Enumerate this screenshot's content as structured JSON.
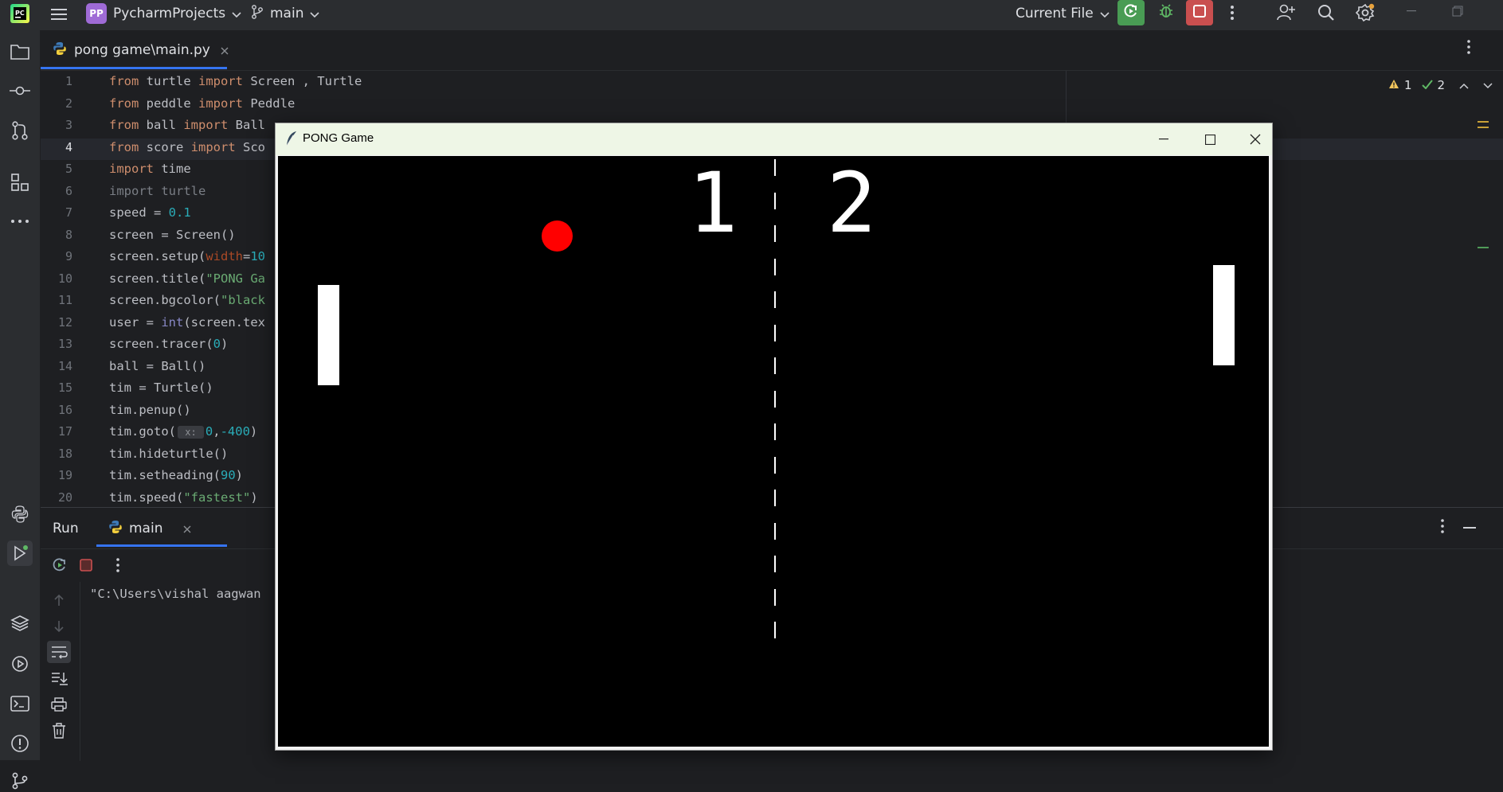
{
  "titlebar": {
    "project_badge": "PP",
    "project_name": "PycharmProjects",
    "branch": "main",
    "run_config": "Current File"
  },
  "editor_tab": {
    "label": "pong game\\main.py"
  },
  "inspections": {
    "warnings": "1",
    "checks": "2"
  },
  "editor": {
    "line_numbers": [
      "1",
      "2",
      "3",
      "4",
      "5",
      "6",
      "7",
      "8",
      "9",
      "10",
      "11",
      "12",
      "13",
      "14",
      "15",
      "16",
      "17",
      "18",
      "19",
      "20"
    ],
    "lines": [
      [
        {
          "t": "from",
          "c": "kw"
        },
        {
          "t": " turtle ",
          "c": ""
        },
        {
          "t": "import",
          "c": "kw"
        },
        {
          "t": " Screen , Turtle",
          "c": ""
        }
      ],
      [
        {
          "t": "from",
          "c": "kw"
        },
        {
          "t": " peddle ",
          "c": ""
        },
        {
          "t": "import",
          "c": "kw"
        },
        {
          "t": " Peddle",
          "c": ""
        }
      ],
      [
        {
          "t": "from",
          "c": "kw"
        },
        {
          "t": " ball ",
          "c": ""
        },
        {
          "t": "import",
          "c": "kw"
        },
        {
          "t": " Ball",
          "c": ""
        }
      ],
      [
        {
          "t": "from",
          "c": "kw"
        },
        {
          "t": " score ",
          "c": ""
        },
        {
          "t": "import",
          "c": "kw"
        },
        {
          "t": " Sco",
          "c": ""
        }
      ],
      [
        {
          "t": "import",
          "c": "kw"
        },
        {
          "t": " time",
          "c": ""
        }
      ],
      [
        {
          "t": "import turtle",
          "c": "gray"
        }
      ],
      [
        {
          "t": "speed = ",
          "c": ""
        },
        {
          "t": "0.1",
          "c": "num"
        }
      ],
      [
        {
          "t": "screen = Screen()",
          "c": ""
        }
      ],
      [
        {
          "t": "screen.setup(",
          "c": ""
        },
        {
          "t": "width",
          "c": "param"
        },
        {
          "t": "=",
          "c": ""
        },
        {
          "t": "10",
          "c": "num"
        }
      ],
      [
        {
          "t": "screen.title(",
          "c": ""
        },
        {
          "t": "\"PONG Ga",
          "c": "str"
        }
      ],
      [
        {
          "t": "screen.bgcolor(",
          "c": ""
        },
        {
          "t": "\"black",
          "c": "str"
        }
      ],
      [
        {
          "t": "user = ",
          "c": ""
        },
        {
          "t": "int",
          "c": "builtin"
        },
        {
          "t": "(screen.tex",
          "c": ""
        }
      ],
      [
        {
          "t": "screen.tracer(",
          "c": ""
        },
        {
          "t": "0",
          "c": "num"
        },
        {
          "t": ")",
          "c": ""
        }
      ],
      [
        {
          "t": "ball = Ball()",
          "c": ""
        }
      ],
      [
        {
          "t": "tim = Turtle()",
          "c": ""
        }
      ],
      [
        {
          "t": "tim.penup()",
          "c": ""
        }
      ],
      [
        {
          "t": "tim.goto(",
          "c": ""
        },
        {
          "t": " x: ",
          "c": "hint"
        },
        {
          "t": "0",
          "c": "num"
        },
        {
          "t": ",",
          "c": ""
        },
        {
          "t": "-400",
          "c": "num"
        },
        {
          "t": ")",
          "c": ""
        }
      ],
      [
        {
          "t": "tim.hideturtle()",
          "c": ""
        }
      ],
      [
        {
          "t": "tim.setheading(",
          "c": ""
        },
        {
          "t": "90",
          "c": "num"
        },
        {
          "t": ")",
          "c": ""
        }
      ],
      [
        {
          "t": "tim.speed(",
          "c": ""
        },
        {
          "t": "\"fastest\"",
          "c": "str"
        },
        {
          "t": ")",
          "c": ""
        }
      ]
    ]
  },
  "run_panel": {
    "title": "Run",
    "tab_label": "main",
    "output_line": "\"C:\\Users\\vishal aagwan"
  },
  "pong_window": {
    "title": "PONG Game",
    "score_left": "1",
    "score_right": "2",
    "ball_color": "#ff0000",
    "background_color": "#000000",
    "paddle_color": "#ffffff"
  },
  "colors": {
    "run_green": "#499c54",
    "stop_red": "#c94f4f",
    "project_badge": "#9f6bd6"
  }
}
